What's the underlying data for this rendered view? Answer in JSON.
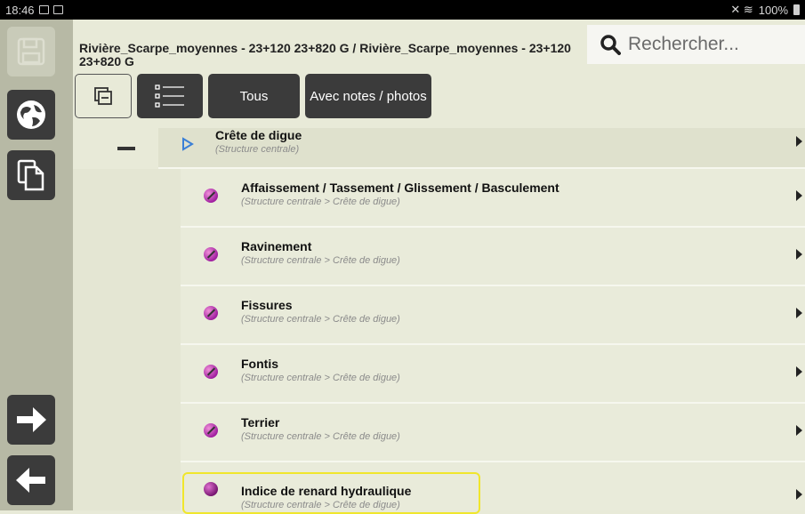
{
  "statusbar": {
    "time": "18:46",
    "battery": "100%"
  },
  "header": {
    "title": "Rivière_Scarpe_moyennes - 23+120 23+820 G / Rivière_Scarpe_moyennes - 23+120 23+820 G",
    "search_placeholder": "Rechercher..."
  },
  "toolbar": {
    "all_label": "Tous",
    "notes_label": "Avec notes / photos"
  },
  "parent": {
    "title": "Crête de digue",
    "subtitle": "(Structure centrale)"
  },
  "items": [
    {
      "title": "Affaissement / Tassement / Glissement / Basculement",
      "subtitle": "(Structure centrale > Crête de digue)"
    },
    {
      "title": "Ravinement",
      "subtitle": "(Structure centrale > Crête de digue)"
    },
    {
      "title": "Fissures",
      "subtitle": "(Structure centrale > Crête de digue)"
    },
    {
      "title": "Fontis",
      "subtitle": "(Structure centrale > Crête de digue)"
    },
    {
      "title": "Terrier",
      "subtitle": "(Structure centrale > Crête de digue)"
    },
    {
      "title": "Indice de renard hydraulique",
      "subtitle": "(Structure centrale > Crête de digue)"
    }
  ],
  "colors": {
    "sidebar": "#b7b9a5",
    "button": "#3b3b3b",
    "highlight": "#f0e62c",
    "status_dot": "#c040c0"
  }
}
